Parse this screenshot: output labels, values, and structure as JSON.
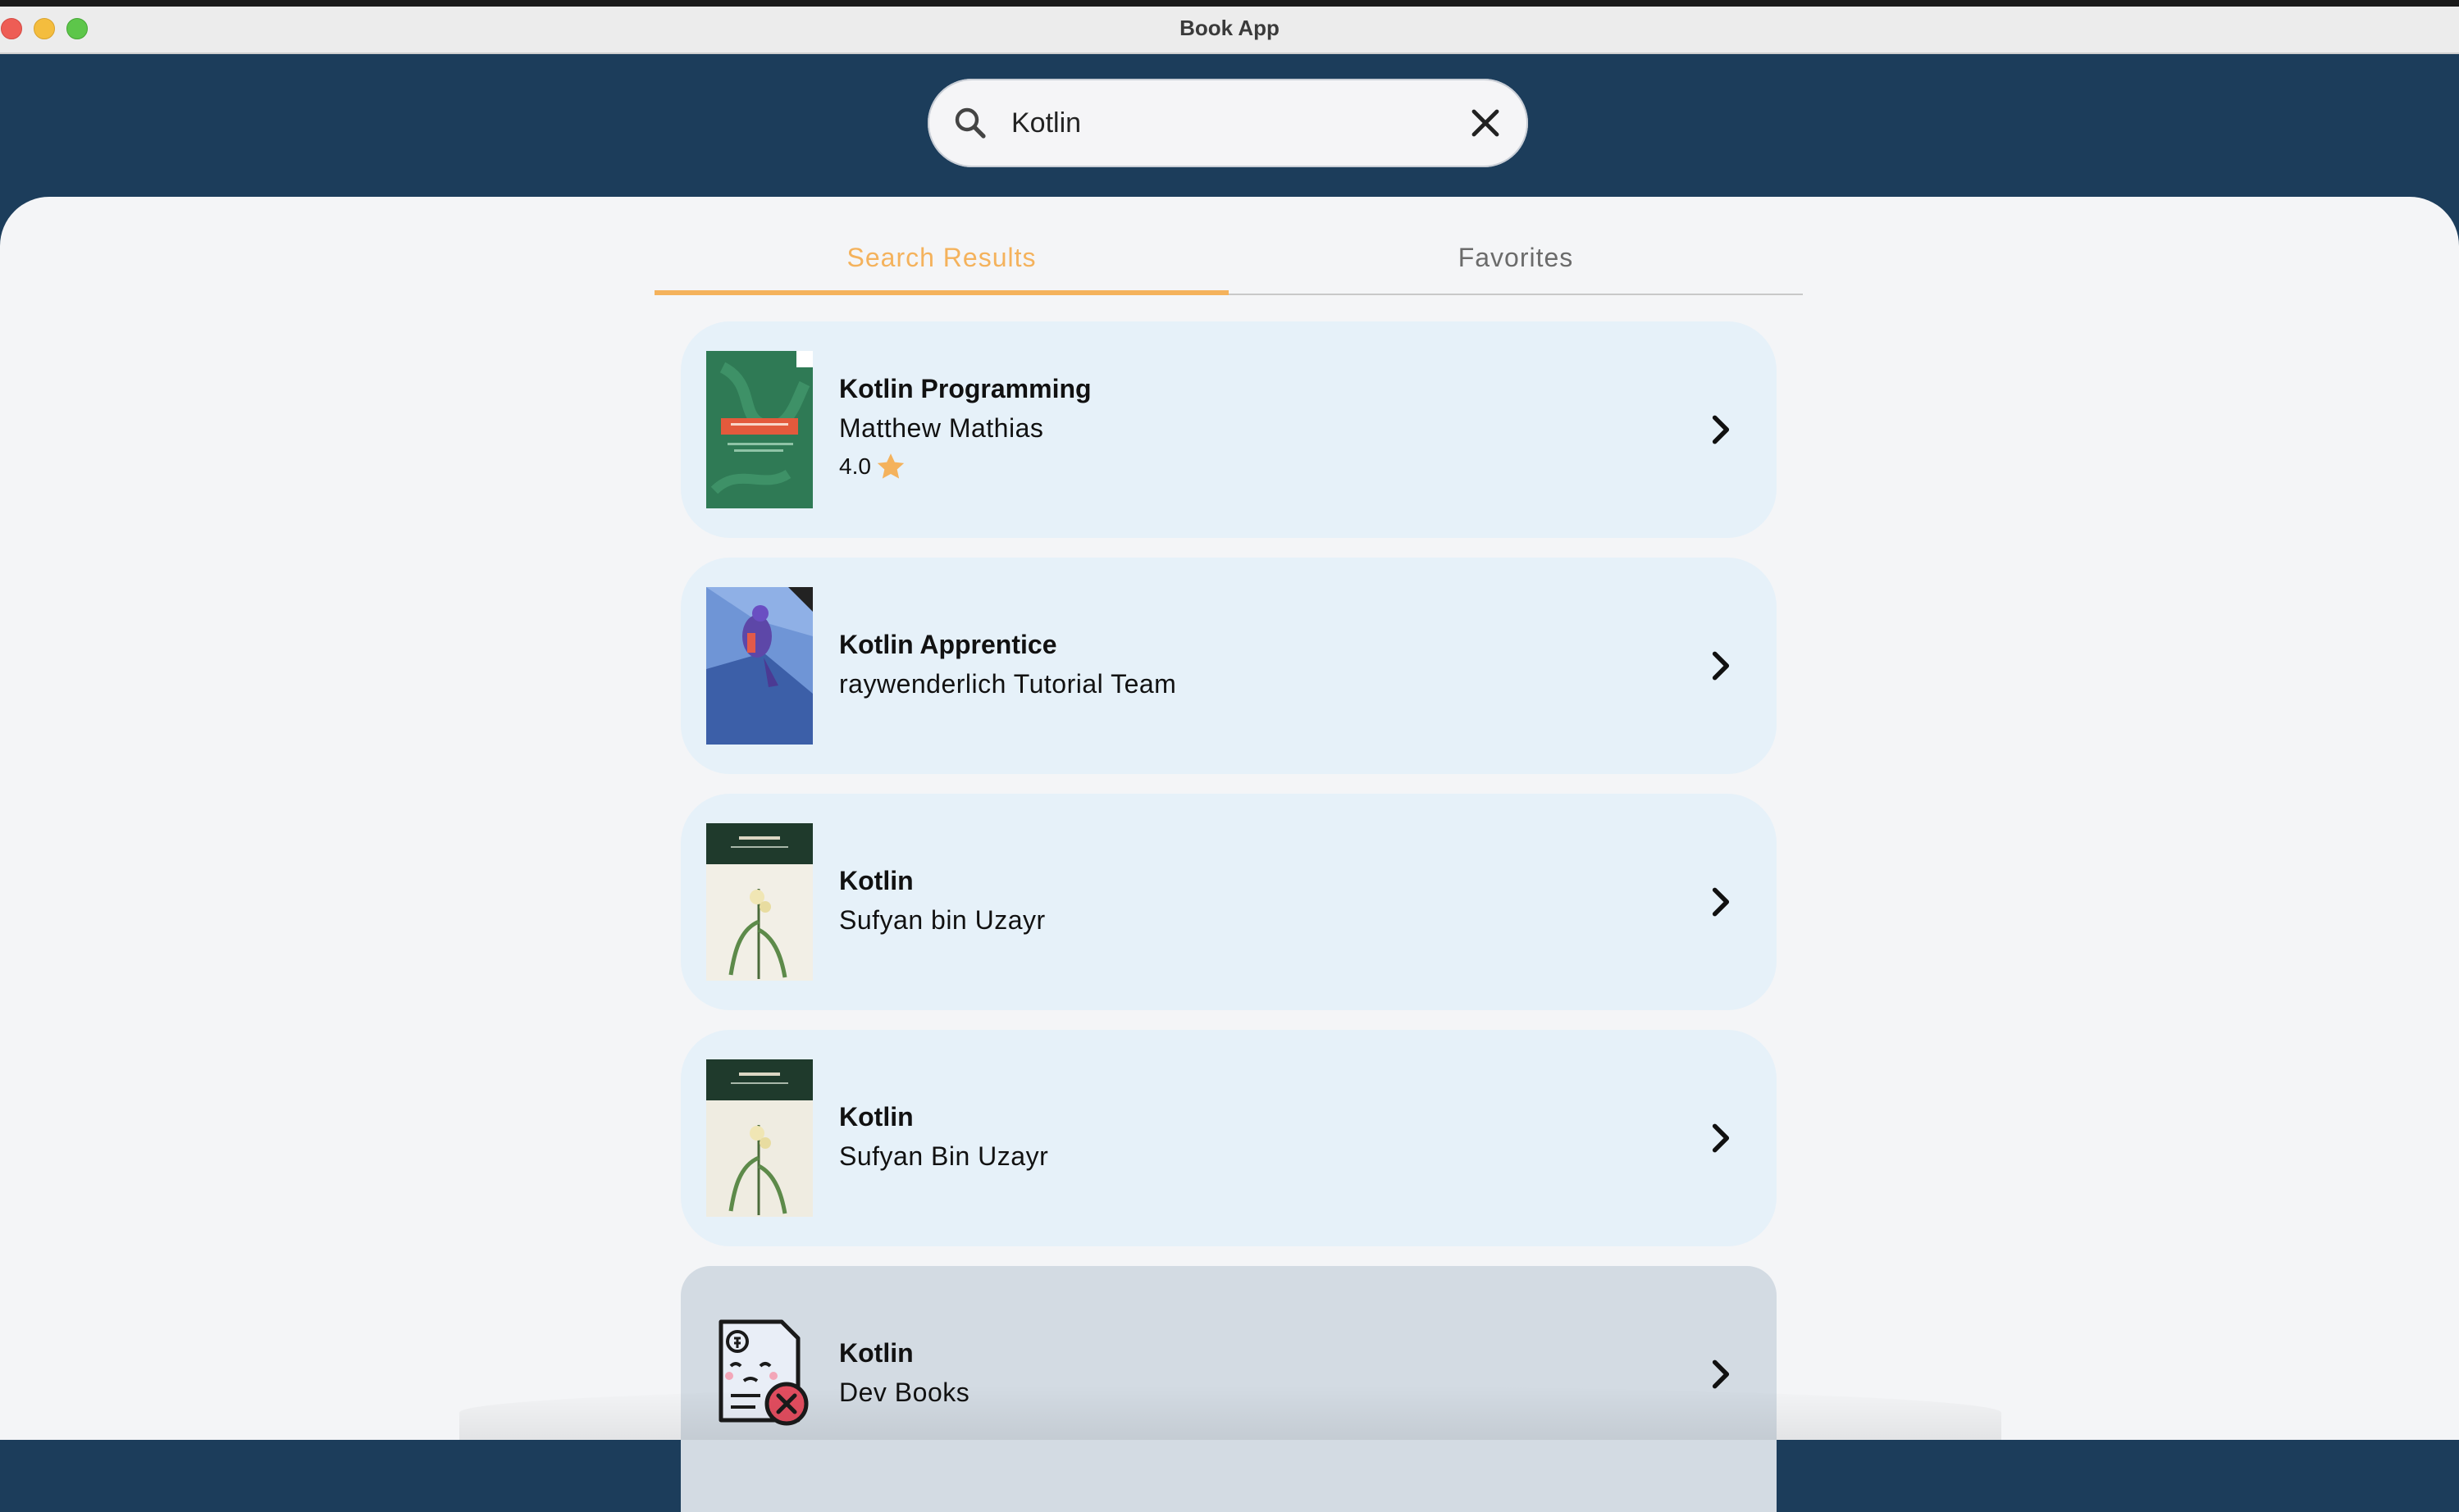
{
  "window": {
    "title": "Book App"
  },
  "search": {
    "value": "Kotlin",
    "placeholder": ""
  },
  "tabs": [
    {
      "label": "Search Results",
      "active": true
    },
    {
      "label": "Favorites",
      "active": false
    }
  ],
  "colors": {
    "header": "#1c3d5b",
    "accent": "#f4b25c",
    "card": "#e6f1f9",
    "panel": "#f4f5f7"
  },
  "results": [
    {
      "title": "Kotlin Programming",
      "author": "Matthew Mathias",
      "rating": "4.0",
      "cover_icon": "book-cover-kotlin-programming"
    },
    {
      "title": "Kotlin Apprentice",
      "author": "raywenderlich Tutorial Team",
      "cover_icon": "book-cover-kotlin-apprentice"
    },
    {
      "title": "Kotlin",
      "author": "Sufyan bin Uzayr",
      "cover_icon": "book-cover-kotlin-ultimate-guide"
    },
    {
      "title": "Kotlin",
      "author": "Sufyan Bin Uzayr",
      "cover_icon": "book-cover-kotlin-ultimate-guide"
    },
    {
      "title": "Kotlin",
      "author": "Dev Books",
      "cover_icon": "no-cover-placeholder-icon"
    }
  ]
}
